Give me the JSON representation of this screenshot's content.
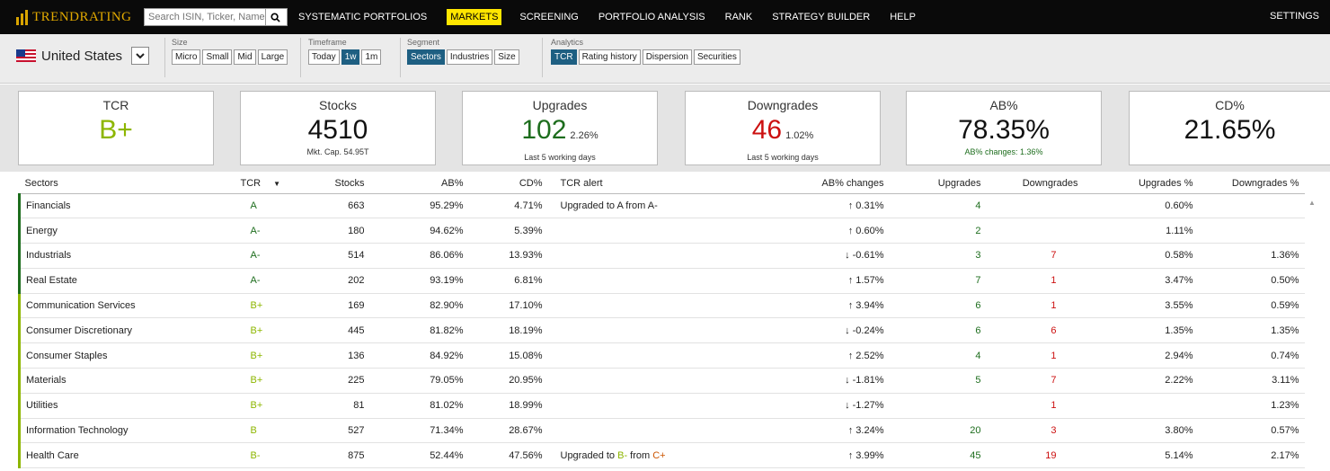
{
  "app": {
    "logo_text": "TRENDRATING",
    "search_placeholder": "Search ISIN, Ticker, Name",
    "nav": [
      "SYSTEMATIC PORTFOLIOS",
      "MARKETS",
      "SCREENING",
      "PORTFOLIO ANALYSIS",
      "RANK",
      "STRATEGY BUILDER",
      "HELP"
    ],
    "active_nav": "MARKETS",
    "settings": "SETTINGS"
  },
  "filters": {
    "country": "United States",
    "size": {
      "label": "Size",
      "options": [
        "Micro",
        "Small",
        "Mid",
        "Large"
      ]
    },
    "timeframe": {
      "label": "Timeframe",
      "options": [
        "Today",
        "1w",
        "1m"
      ],
      "selected": "1w"
    },
    "segment": {
      "label": "Segment",
      "options": [
        "Sectors",
        "Industries",
        "Size"
      ],
      "selected": "Sectors"
    },
    "analytics": {
      "label": "Analytics",
      "options": [
        "TCR",
        "Rating history",
        "Dispersion",
        "Securities"
      ],
      "selected": "TCR"
    }
  },
  "cards": {
    "tcr": {
      "title": "TCR",
      "value": "B+"
    },
    "stocks": {
      "title": "Stocks",
      "value": "4510",
      "sub": "Mkt. Cap. 54.95T"
    },
    "upgrades": {
      "title": "Upgrades",
      "value": "102",
      "pct": "2.26%",
      "sub": "Last 5 working days"
    },
    "downgrades": {
      "title": "Downgrades",
      "value": "46",
      "pct": "1.02%",
      "sub": "Last 5 working days"
    },
    "ab": {
      "title": "AB%",
      "value": "78.35%",
      "sub": "AB% changes: 1.36%"
    },
    "cd": {
      "title": "CD%",
      "value": "21.65%"
    }
  },
  "table": {
    "headers": {
      "sector": "Sectors",
      "tcr": "TCR",
      "stocks": "Stocks",
      "ab": "AB%",
      "cd": "CD%",
      "alert": "TCR alert",
      "ab_changes": "AB% changes",
      "upgrades": "Upgrades",
      "downgrades": "Downgrades",
      "upgrades_pct": "Upgrades %",
      "downgrades_pct": "Downgrades %"
    },
    "rows": [
      {
        "sector": "Financials",
        "tcr": "A",
        "stocks": "663",
        "ab": "95.29%",
        "cd": "4.71%",
        "alert": "Upgraded to A from A-",
        "ab_change": "↑ 0.31%",
        "upgrades": "4",
        "downgrades": "",
        "upgrades_pct": "0.60%",
        "downgrades_pct": ""
      },
      {
        "sector": "Energy",
        "tcr": "A-",
        "stocks": "180",
        "ab": "94.62%",
        "cd": "5.39%",
        "alert": "",
        "ab_change": "↑ 0.60%",
        "upgrades": "2",
        "downgrades": "",
        "upgrades_pct": "1.11%",
        "downgrades_pct": ""
      },
      {
        "sector": "Industrials",
        "tcr": "A-",
        "stocks": "514",
        "ab": "86.06%",
        "cd": "13.93%",
        "alert": "",
        "ab_change": "↓ -0.61%",
        "upgrades": "3",
        "downgrades": "7",
        "upgrades_pct": "0.58%",
        "downgrades_pct": "1.36%"
      },
      {
        "sector": "Real Estate",
        "tcr": "A-",
        "stocks": "202",
        "ab": "93.19%",
        "cd": "6.81%",
        "alert": "",
        "ab_change": "↑ 1.57%",
        "upgrades": "7",
        "downgrades": "1",
        "upgrades_pct": "3.47%",
        "downgrades_pct": "0.50%"
      },
      {
        "sector": "Communication Services",
        "tcr": "B+",
        "stocks": "169",
        "ab": "82.90%",
        "cd": "17.10%",
        "alert": "",
        "ab_change": "↑ 3.94%",
        "upgrades": "6",
        "downgrades": "1",
        "upgrades_pct": "3.55%",
        "downgrades_pct": "0.59%"
      },
      {
        "sector": "Consumer Discretionary",
        "tcr": "B+",
        "stocks": "445",
        "ab": "81.82%",
        "cd": "18.19%",
        "alert": "",
        "ab_change": "↓ -0.24%",
        "upgrades": "6",
        "downgrades": "6",
        "upgrades_pct": "1.35%",
        "downgrades_pct": "1.35%"
      },
      {
        "sector": "Consumer Staples",
        "tcr": "B+",
        "stocks": "136",
        "ab": "84.92%",
        "cd": "15.08%",
        "alert": "",
        "ab_change": "↑ 2.52%",
        "upgrades": "4",
        "downgrades": "1",
        "upgrades_pct": "2.94%",
        "downgrades_pct": "0.74%"
      },
      {
        "sector": "Materials",
        "tcr": "B+",
        "stocks": "225",
        "ab": "79.05%",
        "cd": "20.95%",
        "alert": "",
        "ab_change": "↓ -1.81%",
        "upgrades": "5",
        "downgrades": "7",
        "upgrades_pct": "2.22%",
        "downgrades_pct": "3.11%"
      },
      {
        "sector": "Utilities",
        "tcr": "B+",
        "stocks": "81",
        "ab": "81.02%",
        "cd": "18.99%",
        "alert": "",
        "ab_change": "↓ -1.27%",
        "upgrades": "",
        "downgrades": "1",
        "upgrades_pct": "",
        "downgrades_pct": "1.23%"
      },
      {
        "sector": "Information Technology",
        "tcr": "B",
        "stocks": "527",
        "ab": "71.34%",
        "cd": "28.67%",
        "alert": "",
        "ab_change": "↑ 3.24%",
        "upgrades": "20",
        "downgrades": "3",
        "upgrades_pct": "3.80%",
        "downgrades_pct": "0.57%"
      },
      {
        "sector": "Health Care",
        "tcr": "B-",
        "stocks": "875",
        "ab": "52.44%",
        "cd": "47.56%",
        "alert": "Upgraded to B- from C+",
        "ab_change": "↑ 3.99%",
        "upgrades": "45",
        "downgrades": "19",
        "upgrades_pct": "5.14%",
        "downgrades_pct": "2.17%"
      }
    ]
  },
  "colors": {
    "rating_a": "#1d6d1d",
    "rating_b": "#8db600",
    "upgrade": "#1d6d1d",
    "downgrade": "#cc1010",
    "nav_active": "#ffe600",
    "selected_btn": "#1e5f82"
  }
}
